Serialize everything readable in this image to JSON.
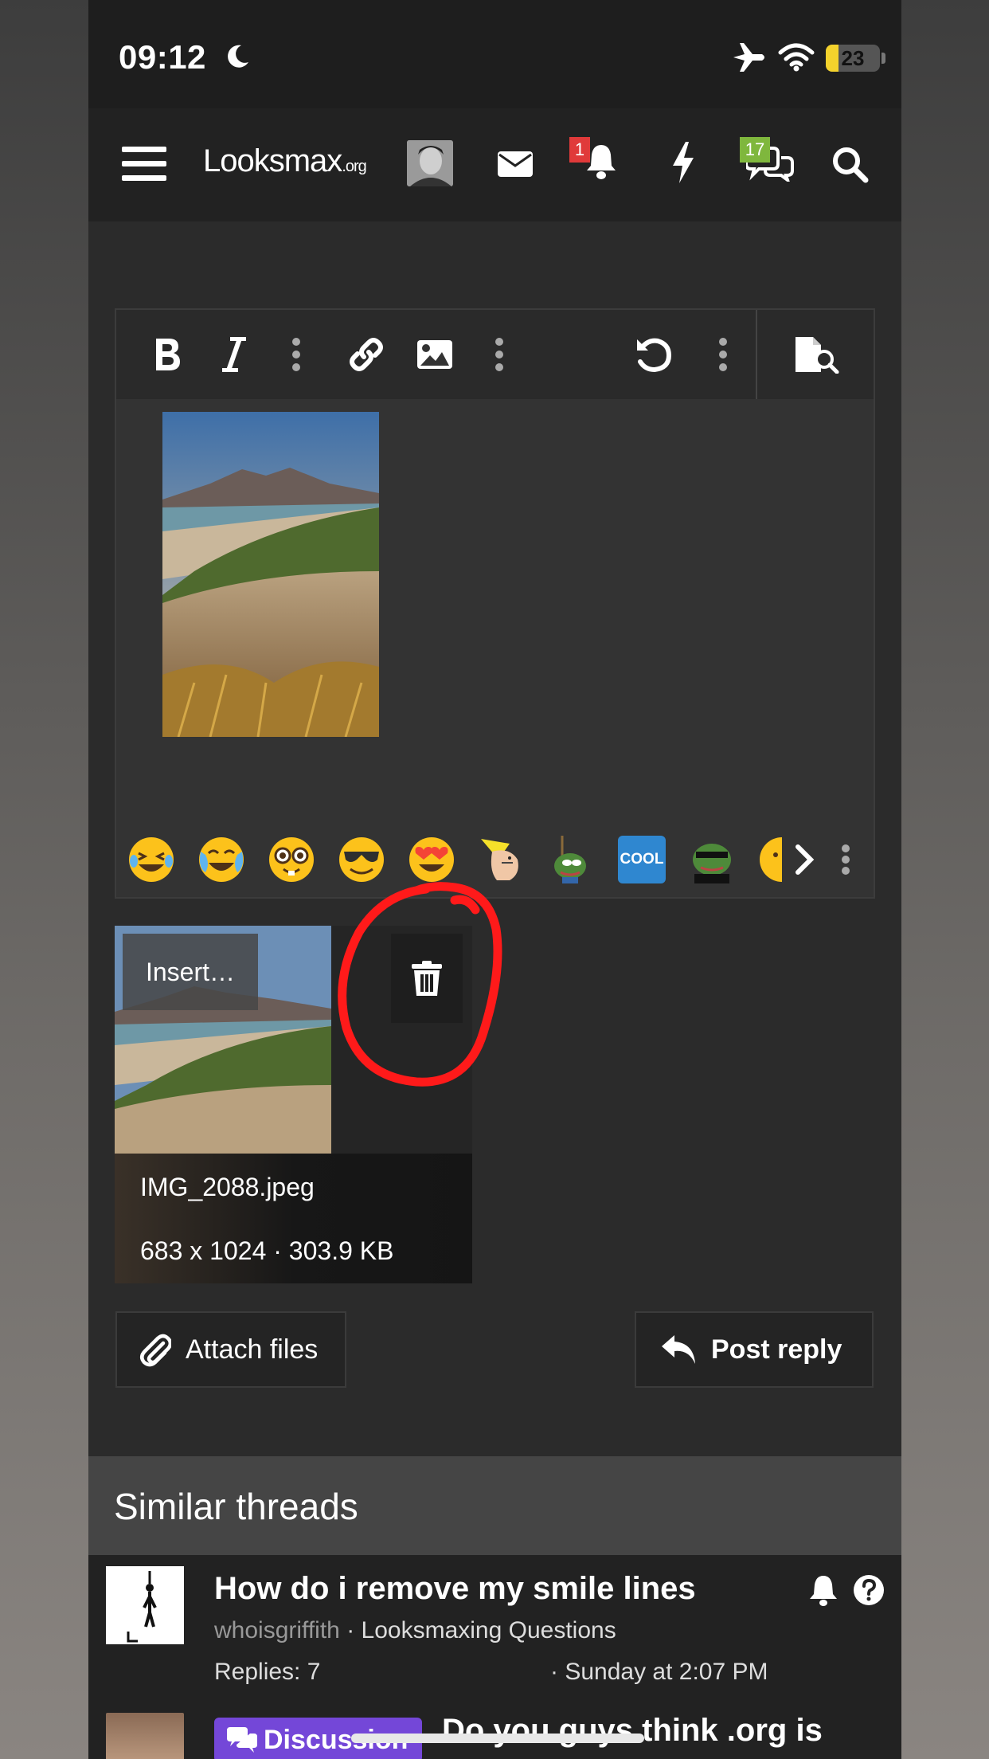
{
  "status_bar": {
    "time": "09:12",
    "battery_level": "23",
    "battery_fraction": 0.23,
    "icons": [
      "moon-icon",
      "airplane-icon",
      "wifi-icon",
      "battery-icon"
    ]
  },
  "nav": {
    "logo_main": "Looksmax",
    "logo_suffix": ".org",
    "notification_count": "1",
    "conversation_count": "17",
    "icons": [
      "menu-icon",
      "avatar",
      "envelope-icon",
      "bell-icon",
      "bolt-icon",
      "chat-icon",
      "search-icon"
    ]
  },
  "editor": {
    "toolbar_icons": [
      "bold-icon",
      "italic-icon",
      "more-vertical-icon",
      "link-icon",
      "image-icon",
      "more-vertical-icon",
      "undo-icon",
      "more-vertical-icon",
      "preview-icon"
    ],
    "emoji_bar_icons": [
      "laughing-emoji",
      "crying-laughing-emoji",
      "nerd-emoji",
      "sunglasses-emoji",
      "heart-eyes-emoji",
      "chad-emoji",
      "pepe-hang-emoji",
      "cool-emoji",
      "pepe-sunglasses-emoji",
      "partial-emoji",
      "chevron-right-icon",
      "more-vertical-icon"
    ],
    "cool_label": "COOL"
  },
  "attachment": {
    "insert_label": "Insert…",
    "file_name": "IMG_2088.jpeg",
    "file_meta": "683 x 1024 · 303.9 KB"
  },
  "buttons": {
    "attach_label": "Attach files",
    "post_label": "Post reply"
  },
  "similar": {
    "heading": "Similar threads",
    "thread1": {
      "title": "How do i remove my smile lines",
      "user": "whoisgriffith",
      "forum": " · Looksmaxing Questions",
      "replies": "Replies: 7",
      "date": "· Sunday at 2:07 PM"
    },
    "thread2": {
      "badge": "Discussion",
      "title": "Do you guys think .org is"
    }
  },
  "colors": {
    "annotation": "#ff1a1a",
    "discussion_badge": "#7447d8",
    "notification_badge": "#e03a3a",
    "conversation_badge": "#7fb73d",
    "battery": "#f4d22c"
  }
}
